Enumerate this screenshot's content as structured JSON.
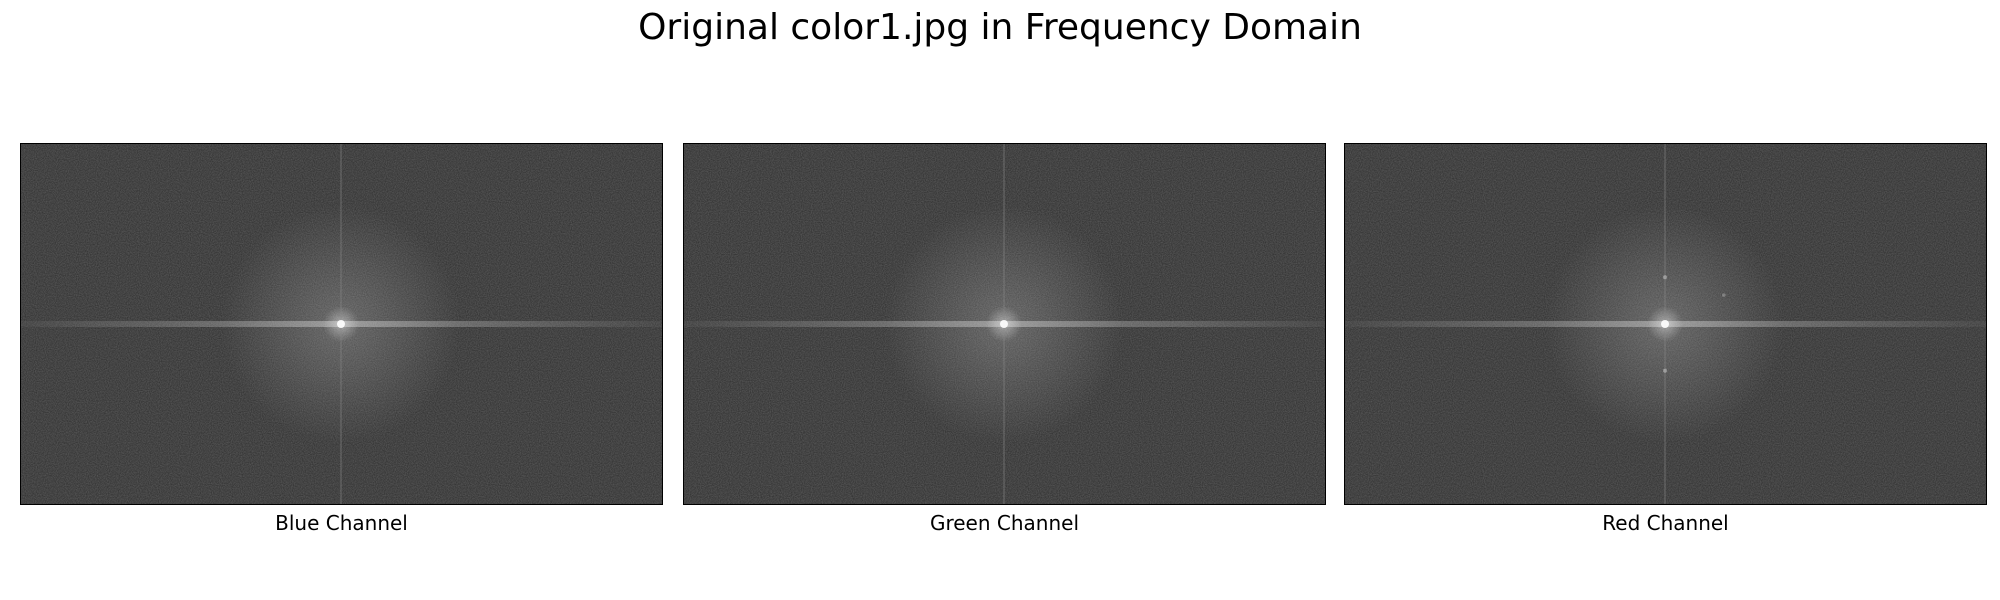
{
  "figure": {
    "title": "Original color1.jpg in Frequency Domain"
  },
  "panels": [
    {
      "caption": "Blue Channel",
      "variant": "blue"
    },
    {
      "caption": "Green Channel",
      "variant": "green"
    },
    {
      "caption": "Red Channel",
      "variant": "red"
    }
  ],
  "colors": {
    "spectrum_background": "#5e5e5e",
    "spectrum_center": "#ffffff",
    "axis_line": "#8a8a8a",
    "frame": "#000000"
  }
}
